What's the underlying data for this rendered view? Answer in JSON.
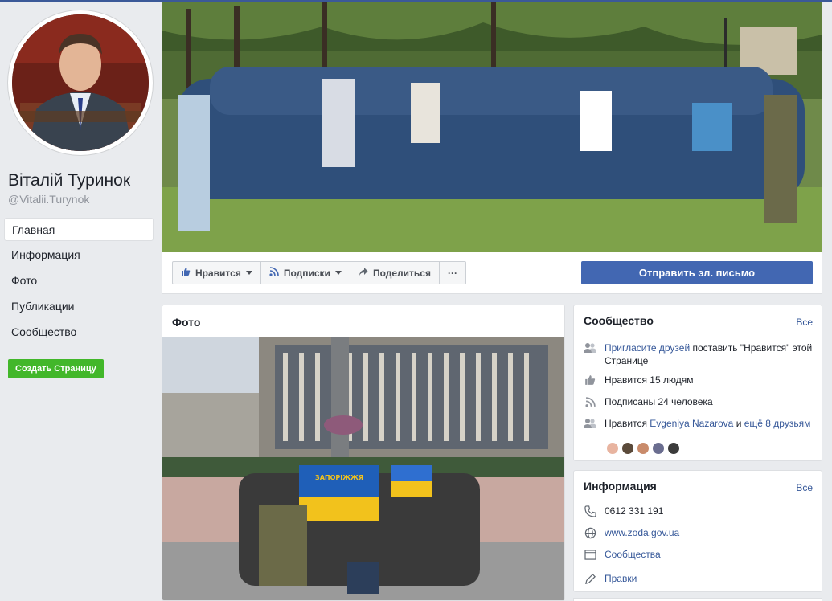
{
  "page": {
    "name": "Віталій Туринок",
    "handle": "@Vitalii.Turynok"
  },
  "nav": {
    "items": [
      "Главная",
      "Информация",
      "Фото",
      "Публикации",
      "Сообщество"
    ],
    "create_page": "Создать Страницу"
  },
  "actions": {
    "like": "Нравится",
    "follow": "Подписки",
    "share": "Поделиться",
    "more": "···",
    "email": "Отправить эл. письмо"
  },
  "photos": {
    "title": "Фото",
    "flag_text": "ЗАПОРІЖЖЯ"
  },
  "community": {
    "title": "Сообщество",
    "see_all": "Все",
    "invite_link": "Пригласите друзей",
    "invite_text": " поставить \"Нравится\" этой Странице",
    "likes": "Нравится 15 людям",
    "followers": "Подписаны 24 человека",
    "friends_prefix": "Нравится ",
    "friend_name": "Evgeniya Nazarova",
    "friends_and": " и ",
    "friends_more": "ещё 8 друзьям",
    "friend_colors": [
      "#e8b4a0",
      "#5b4a3a",
      "#c98b6b",
      "#6a6d8f",
      "#3b3b3b"
    ]
  },
  "info": {
    "title": "Информация",
    "see_all": "Все",
    "phone": "0612 331 191",
    "website": "www.zoda.gov.ua",
    "category": "Сообщества",
    "edits": "Правки"
  },
  "colors": {
    "facebook_blue": "#4267b2",
    "link": "#365899",
    "green_button": "#42b72a"
  }
}
